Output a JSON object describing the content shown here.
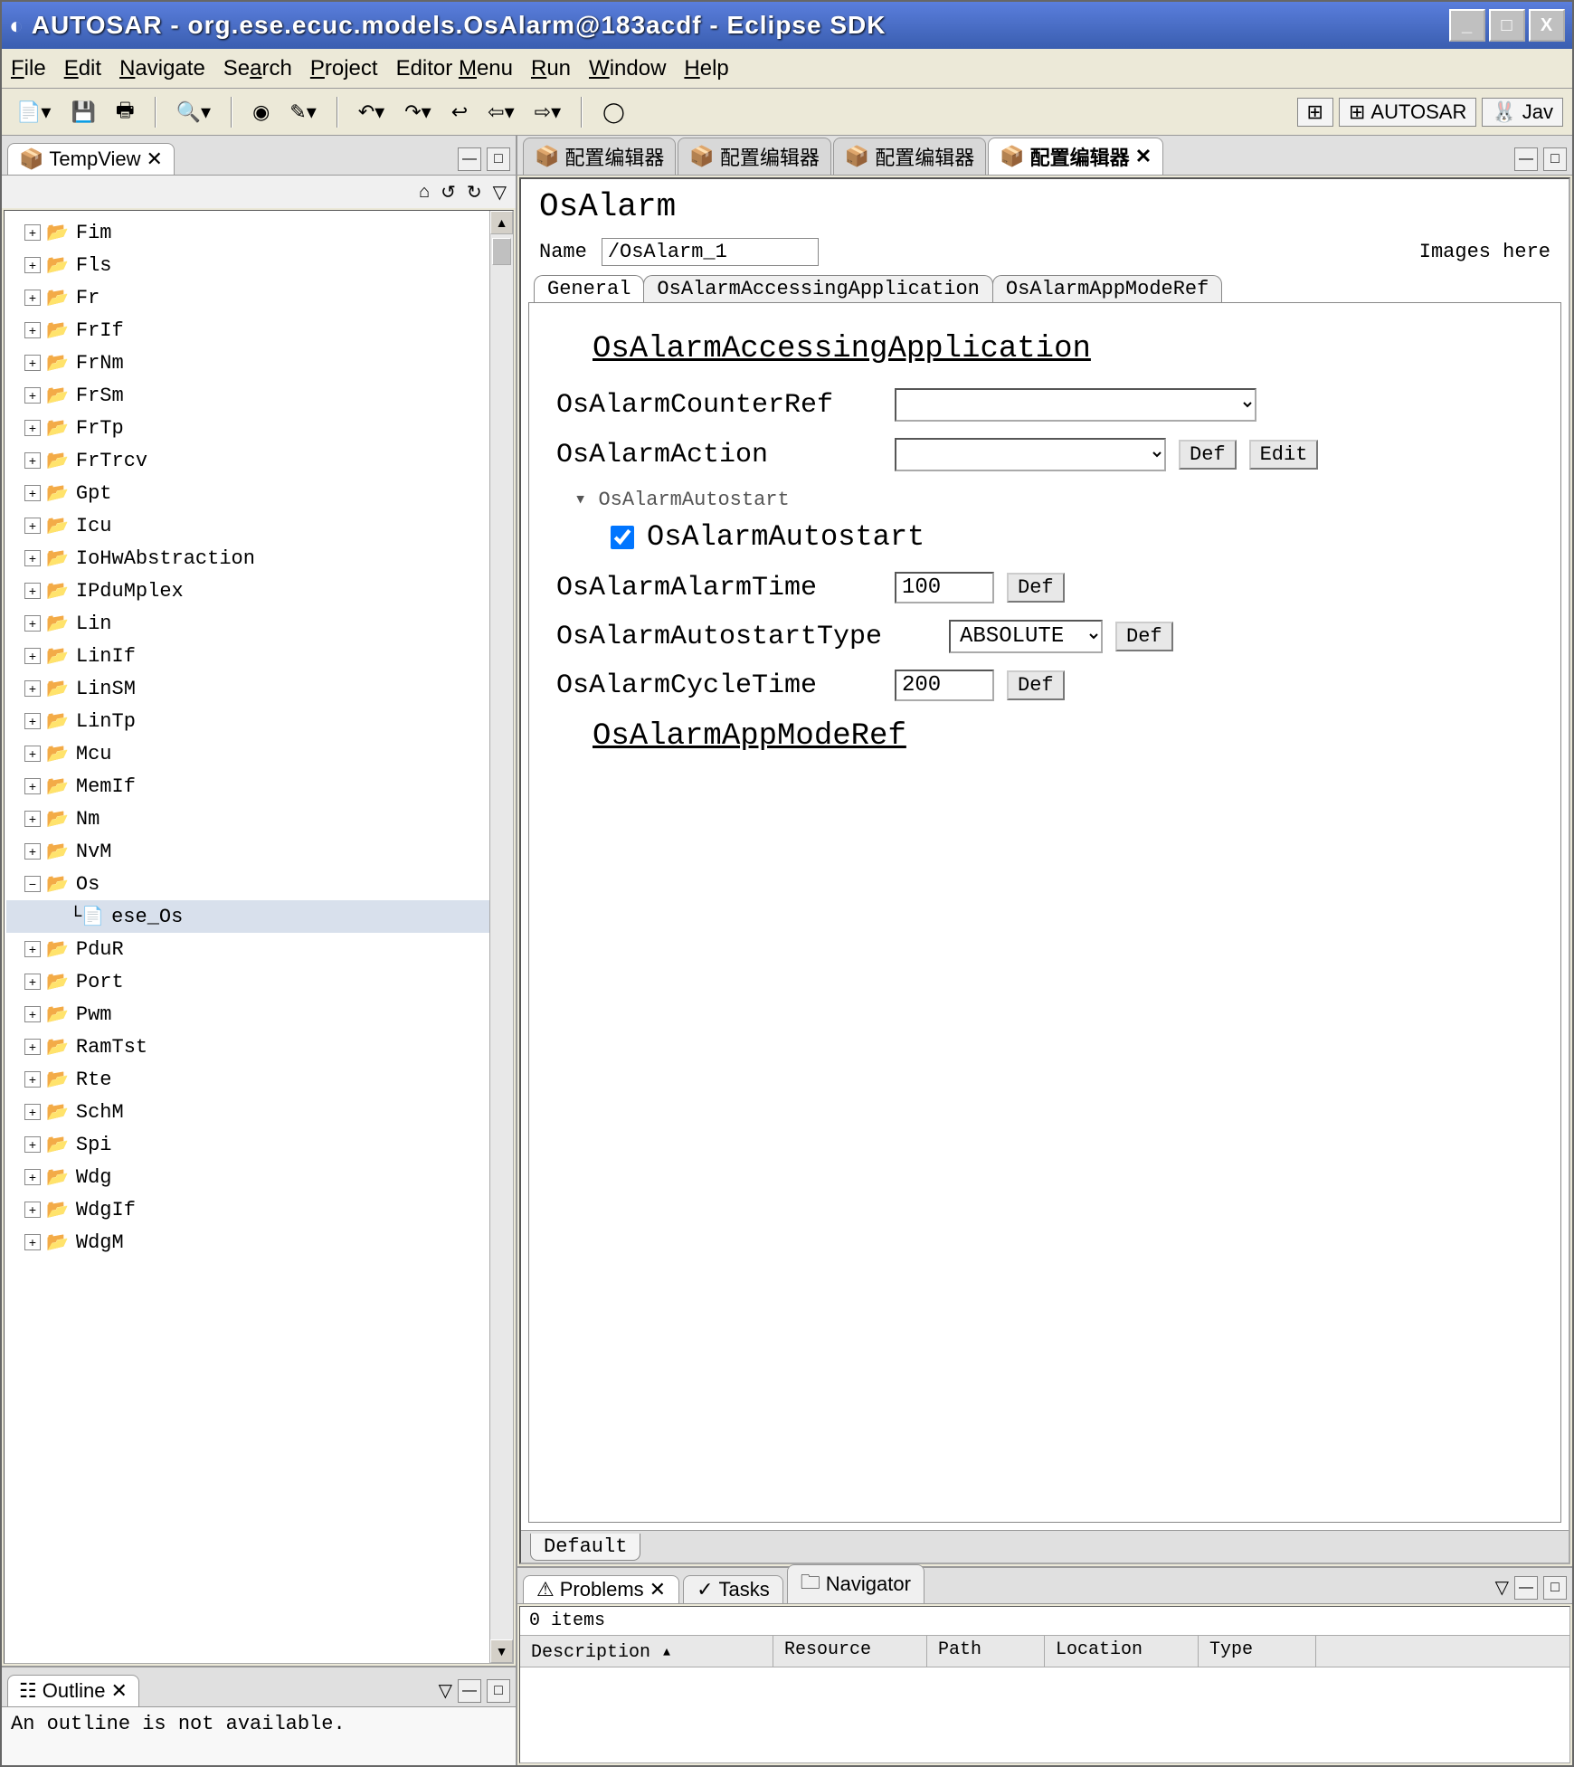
{
  "window": {
    "title": "AUTOSAR - org.ese.ecuc.models.OsAlarm@183acdf - Eclipse SDK"
  },
  "win_controls": {
    "min": "_",
    "max": "□",
    "close": "X"
  },
  "menu": {
    "file": "File",
    "edit": "Edit",
    "navigate": "Navigate",
    "search": "Search",
    "project": "Project",
    "editormenu": "Editor Menu",
    "run": "Run",
    "window": "Window",
    "help": "Help"
  },
  "perspective": {
    "autosar": "AUTOSAR",
    "java": "Jav"
  },
  "tempview": {
    "title": "TempView"
  },
  "tree": {
    "items": [
      {
        "label": "Fim"
      },
      {
        "label": "Fls"
      },
      {
        "label": "Fr"
      },
      {
        "label": "FrIf"
      },
      {
        "label": "FrNm"
      },
      {
        "label": "FrSm"
      },
      {
        "label": "FrTp"
      },
      {
        "label": "FrTrcv"
      },
      {
        "label": "Gpt"
      },
      {
        "label": "Icu"
      },
      {
        "label": "IoHwAbstraction"
      },
      {
        "label": "IPduMplex"
      },
      {
        "label": "Lin"
      },
      {
        "label": "LinIf"
      },
      {
        "label": "LinSM"
      },
      {
        "label": "LinTp"
      },
      {
        "label": "Mcu"
      },
      {
        "label": "MemIf"
      },
      {
        "label": "Nm"
      },
      {
        "label": "NvM"
      },
      {
        "label": "Os",
        "expanded": true,
        "children": [
          {
            "label": "ese_Os"
          }
        ]
      },
      {
        "label": "PduR"
      },
      {
        "label": "Port"
      },
      {
        "label": "Pwm"
      },
      {
        "label": "RamTst"
      },
      {
        "label": "Rte"
      },
      {
        "label": "SchM"
      },
      {
        "label": "Spi"
      },
      {
        "label": "Wdg"
      },
      {
        "label": "WdgIf"
      },
      {
        "label": "WdgM"
      }
    ]
  },
  "outline": {
    "title": "Outline",
    "msg": "An outline is not available."
  },
  "editor_tabs": {
    "t1": "配置编辑器",
    "t2": "配置编辑器",
    "t3": "配置编辑器",
    "t4": "配置编辑器"
  },
  "editor": {
    "heading": "OsAlarm",
    "name_label": "Name",
    "name_value": "/OsAlarm_1",
    "images_here": "Images here",
    "subtabs": {
      "general": "General",
      "aaa": "OsAlarmAccessingApplication",
      "amr": "OsAlarmAppModeRef"
    },
    "section1": "OsAlarmAccessingApplication",
    "counter_ref_label": "OsAlarmCounterRef",
    "counter_ref_value": "",
    "action_label": "OsAlarmAction",
    "action_value": "",
    "def_btn": "Def",
    "edit_btn": "Edit",
    "autostart_twisty": "OsAlarmAutostart",
    "autostart_check_label": "OsAlarmAutostart",
    "alarm_time_label": "OsAlarmAlarmTime",
    "alarm_time_value": "100",
    "autostart_type_label": "OsAlarmAutostartType",
    "autostart_type_value": "ABSOLUTE",
    "cycle_time_label": "OsAlarmCycleTime",
    "cycle_time_value": "200",
    "section2": "OsAlarmAppModeRef",
    "bottom_tab": "Default"
  },
  "problems": {
    "tab_problems": "Problems",
    "tab_tasks": "Tasks",
    "tab_navigator": "Navigator",
    "status": "0 items",
    "col_desc": "Description",
    "col_res": "Resource",
    "col_path": "Path",
    "col_loc": "Location",
    "col_type": "Type"
  }
}
